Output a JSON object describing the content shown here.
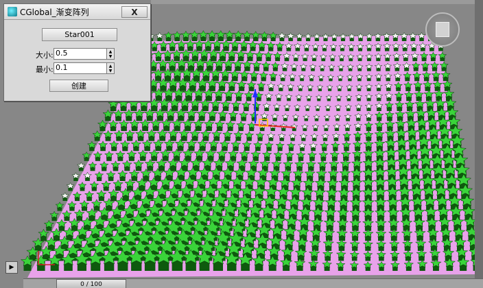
{
  "dialog": {
    "title": "CGlobal_渐变阵列",
    "close_label": "X",
    "target_button_label": "Star001",
    "size_label": "大小:",
    "size_value": "0.5",
    "min_label": "最小:",
    "min_value": "0.1",
    "create_button_label": "创建"
  },
  "timeline": {
    "frame_display": "0 / 100"
  },
  "scene": {
    "plane_color": "#e8a2ea",
    "star_color": "#3ad43a",
    "star_dark": "#0e5a0e",
    "viewport_bg": "#878787"
  },
  "icons": {
    "play": "play-icon",
    "nav_cube": "view-cube-icon"
  }
}
